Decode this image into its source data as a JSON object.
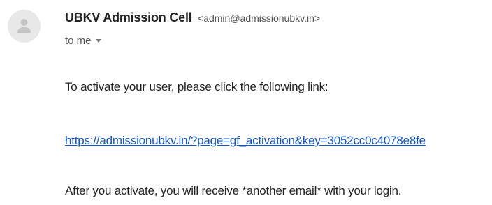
{
  "sender": {
    "name": "UBKV Admission Cell",
    "email": "<admin@admissionubkv.in>"
  },
  "recipient": {
    "label": "to me"
  },
  "icons": {
    "avatar": "default-avatar-icon",
    "dropdown": "chevron-down-icon"
  },
  "colors": {
    "link": "#1155cc",
    "text": "#222222",
    "muted": "#555555"
  },
  "body": {
    "intro": "To activate your user, please click the following link:",
    "link": "https://admissionubkv.in/?page=gf_activation&key=3052cc0c4078e8fe",
    "outro": "After you activate, you will receive *another email* with your login."
  }
}
